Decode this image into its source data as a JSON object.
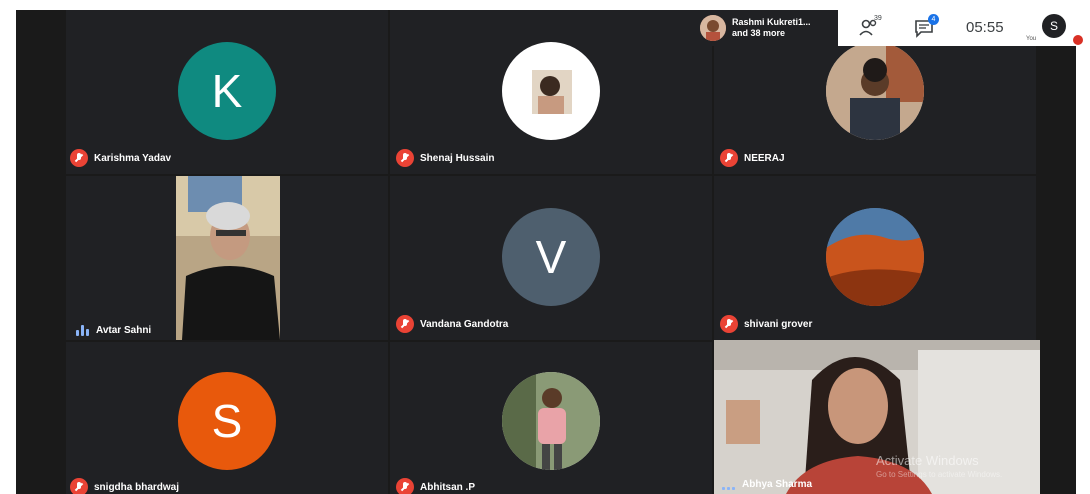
{
  "topbar": {
    "participants_line1": "Rashmi Kukreti1...",
    "participants_line2": "and 38 more",
    "people_count": "39",
    "chat_badge": "4",
    "clock": "05:55",
    "you_label": "You",
    "you_initial": "S"
  },
  "tiles": [
    {
      "name": "Karishma Yadav",
      "initial": "K",
      "color": "#0f8a80",
      "mic": "muted"
    },
    {
      "name": "Shenaj Hussain",
      "initial": "",
      "color": "#ffffff",
      "mic": "muted"
    },
    {
      "name": "NEERAJ",
      "initial": "",
      "color": "#e8e8e8",
      "mic": "muted"
    },
    {
      "name": "Avtar Sahni",
      "initial": "",
      "color": "#3a3a3a",
      "mic": "speaking"
    },
    {
      "name": "Vandana Gandotra",
      "initial": "V",
      "color": "#4e5f6e",
      "mic": "muted"
    },
    {
      "name": "shivani grover",
      "initial": "",
      "color": "#c9541c",
      "mic": "muted"
    },
    {
      "name": "snigdha bhardwaj",
      "initial": "S",
      "color": "#e8590c",
      "mic": "muted"
    },
    {
      "name": "Abhitsan .P",
      "initial": "",
      "color": "#e8e8e8",
      "mic": "muted"
    },
    {
      "name": "Abhya Sharma",
      "initial": "",
      "color": "#cfc8c0",
      "mic": "speaking"
    }
  ],
  "watermark": {
    "line1": "Activate Windows",
    "line2": "Go to Settings to activate Windows."
  },
  "colors": {
    "tile_bg": "#202124",
    "mic_off": "#ea4335",
    "speaking": "#8ab4f8",
    "accent": "#1a73e8"
  }
}
